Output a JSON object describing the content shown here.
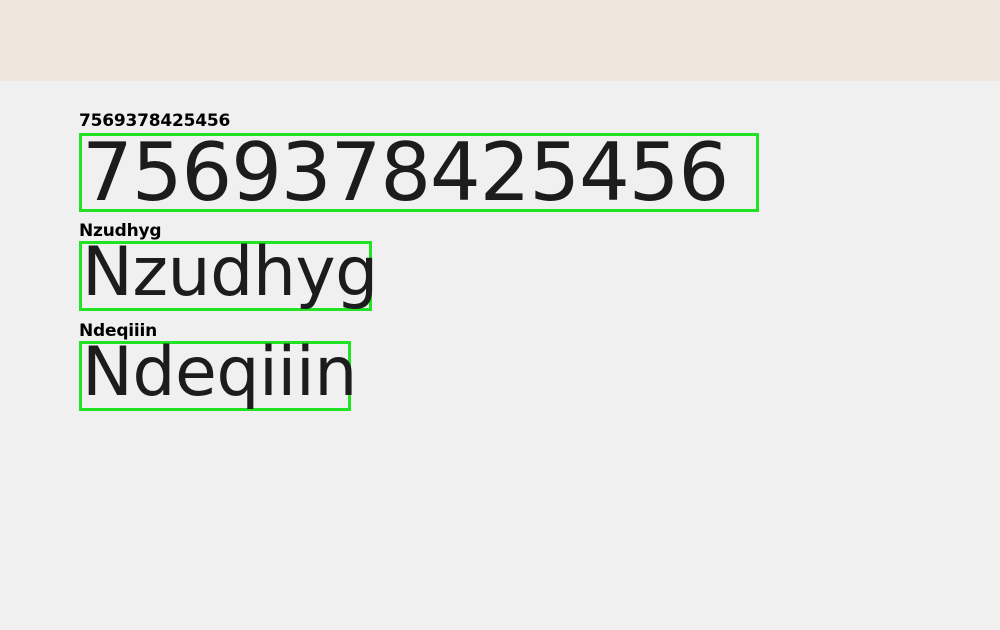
{
  "colors": {
    "top_band": "#efe6de",
    "background": "#f0f0f0",
    "box_border": "#22e322",
    "text": "#1c1c1c"
  },
  "items": [
    {
      "caption": "7569378425456",
      "text": "7569378425456"
    },
    {
      "caption": "Nzudhyg",
      "text": "Nzudhyg"
    },
    {
      "caption": "Ndeqiiin",
      "text": "Ndeqiiin"
    }
  ]
}
